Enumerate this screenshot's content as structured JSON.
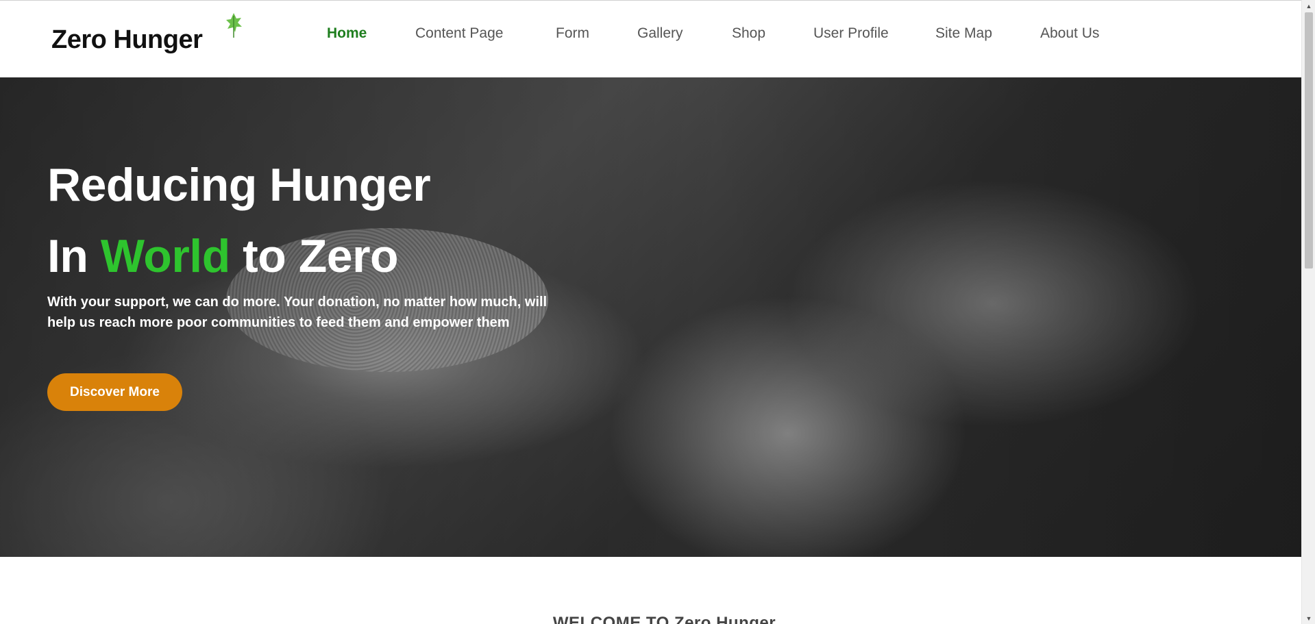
{
  "header": {
    "logo_text": "Zero Hunger",
    "logo_icon": "leaf-icon",
    "nav": [
      {
        "label": "Home",
        "active": true
      },
      {
        "label": "Content Page",
        "active": false
      },
      {
        "label": "Form",
        "active": false
      },
      {
        "label": "Gallery",
        "active": false
      },
      {
        "label": "Shop",
        "active": false
      },
      {
        "label": "User Profile",
        "active": false
      },
      {
        "label": "Site Map",
        "active": false
      },
      {
        "label": "About Us",
        "active": false
      }
    ]
  },
  "hero": {
    "title_line1": "Reducing Hunger",
    "title_line2_prefix": "In",
    "title_line2_highlight": "World",
    "title_line2_suffix": "to Zero",
    "description": "With your support, we can do more. Your donation, no matter how much, will help us reach more poor communities to feed them and empower them",
    "button_label": "Discover More"
  },
  "welcome": {
    "heading": "WELCOME TO Zero Hunger"
  },
  "colors": {
    "accent_green": "#1e7e1e",
    "highlight_green": "#2ec42e",
    "button_orange": "#d9820a"
  }
}
